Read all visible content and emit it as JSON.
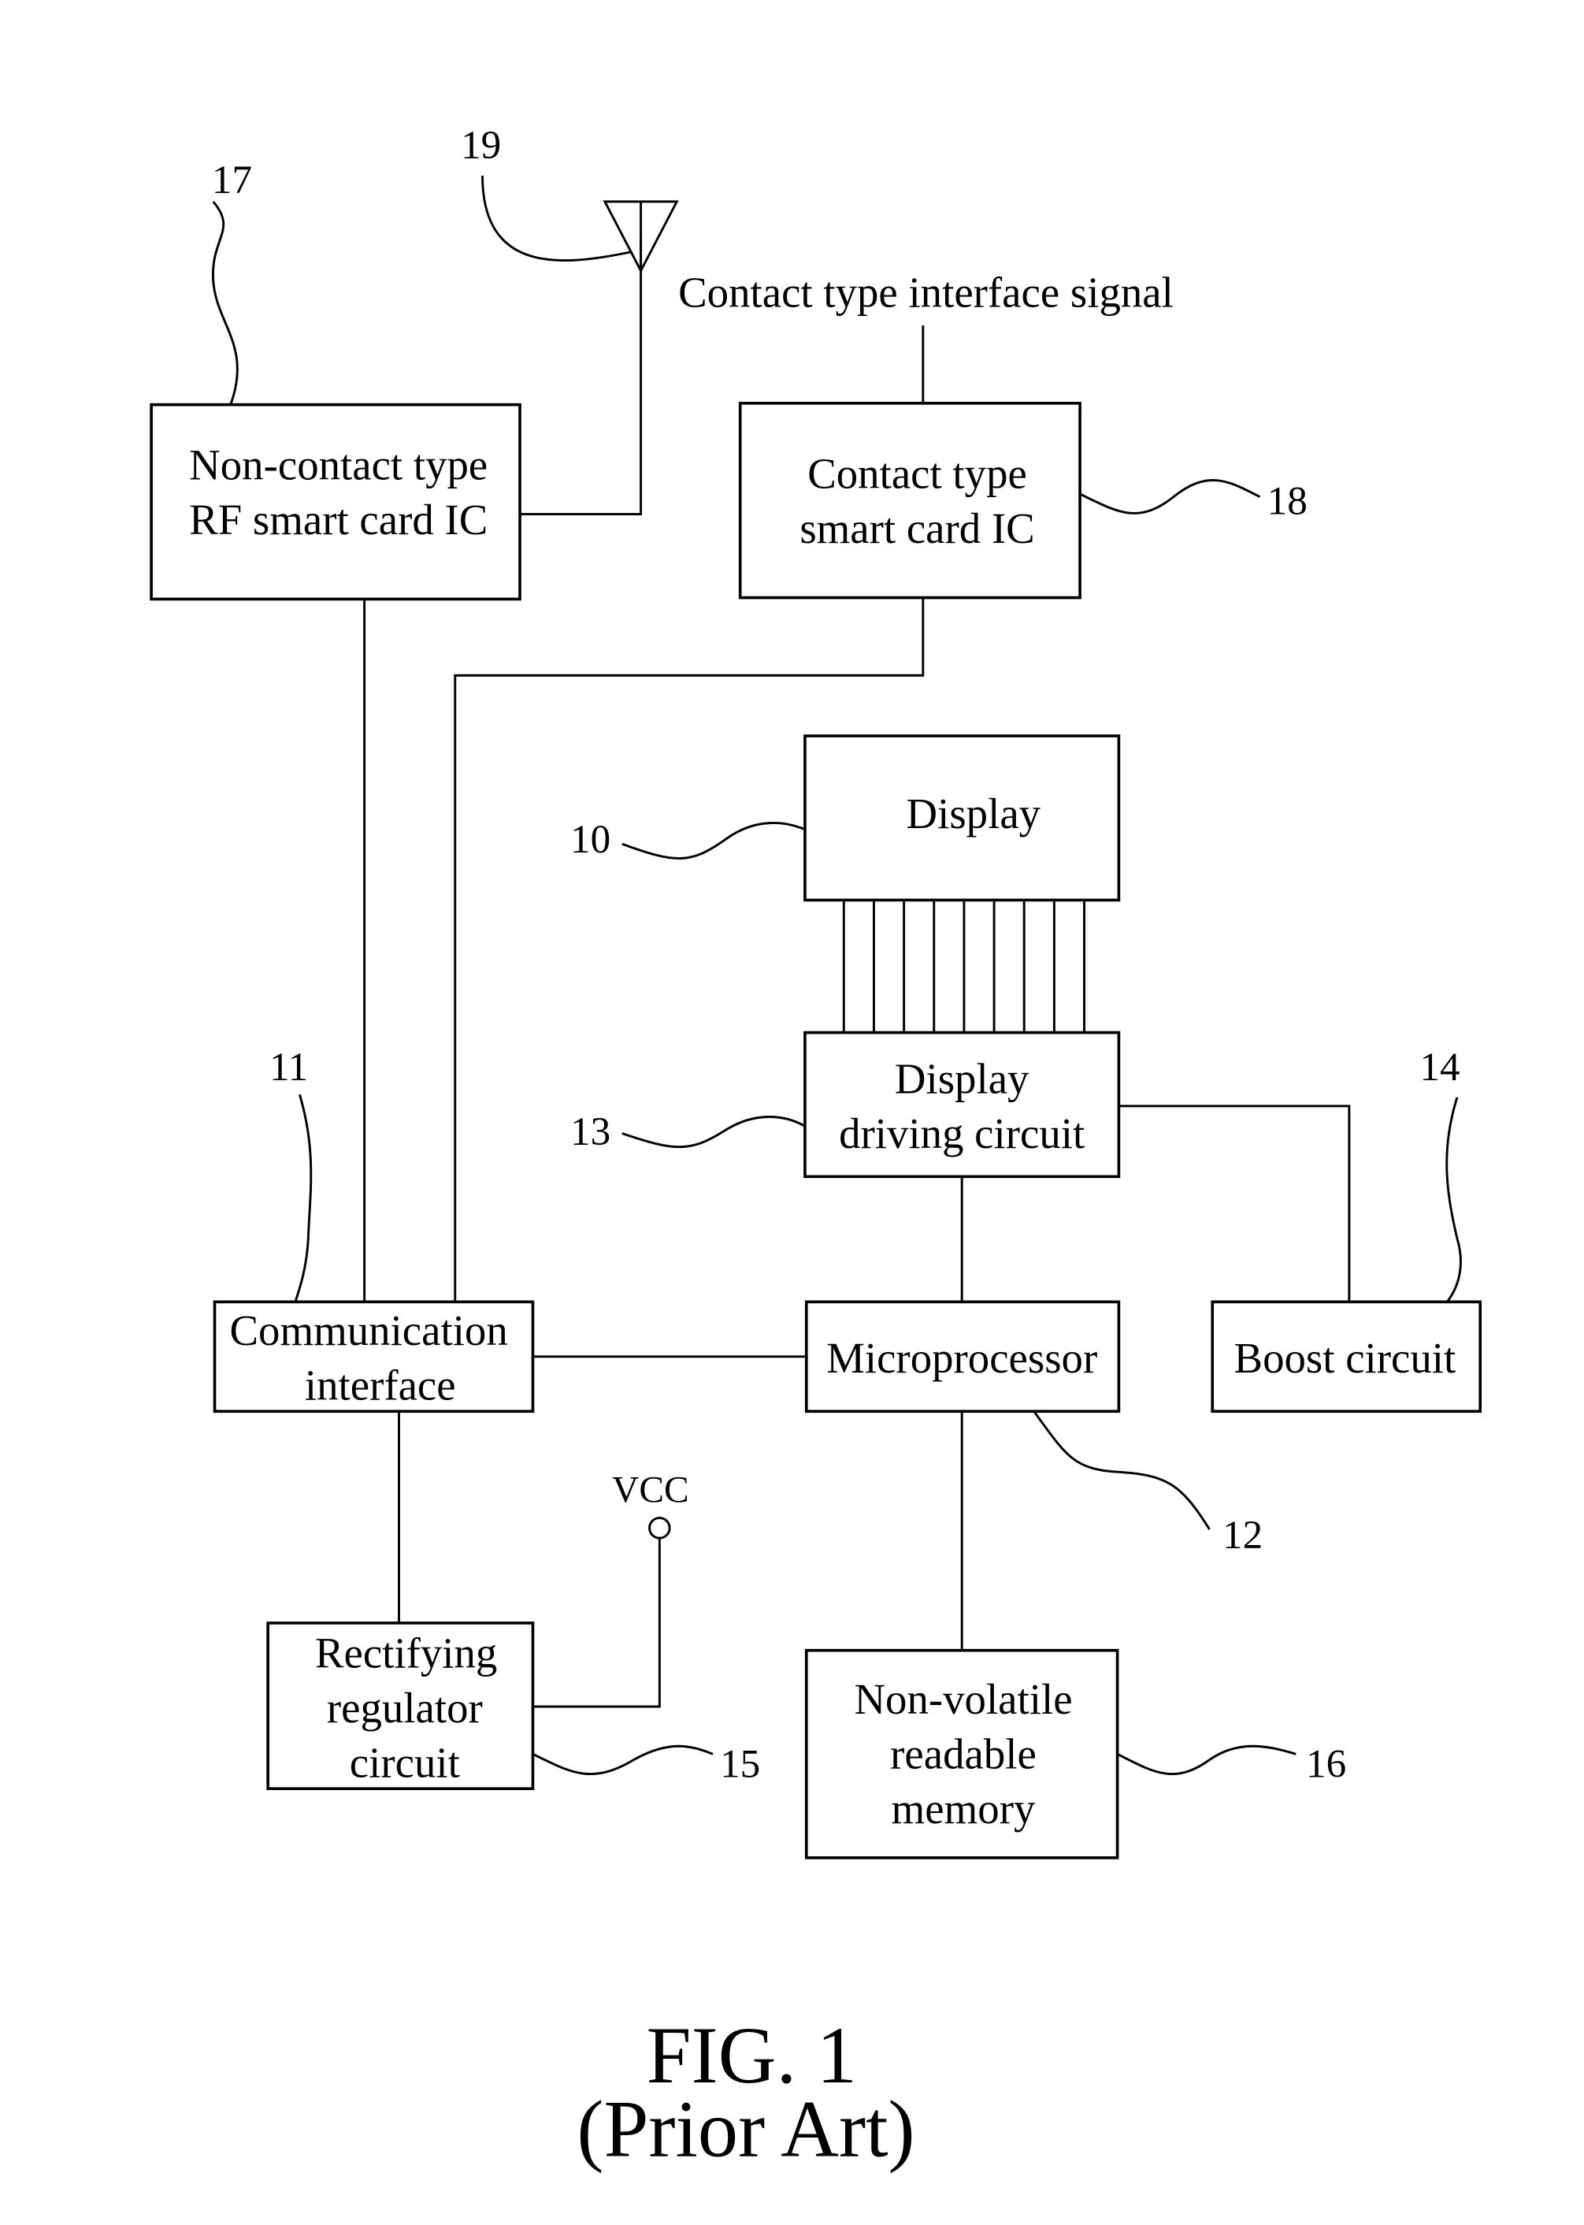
{
  "figure": {
    "caption": "FIG. 1",
    "subcaption": "(Prior Art)"
  },
  "blocks": {
    "rf_ic": {
      "ref": "17",
      "lines": [
        "Non-contact type",
        "RF smart card IC"
      ]
    },
    "contact_ic": {
      "ref": "18",
      "lines": [
        "Contact type",
        "smart card IC"
      ]
    },
    "display": {
      "ref": "10",
      "lines": [
        "Display"
      ]
    },
    "driver": {
      "ref": "13",
      "lines": [
        "Display",
        "driving circuit"
      ]
    },
    "comm": {
      "ref": "11",
      "lines": [
        "Communication",
        "interface"
      ]
    },
    "micro": {
      "ref": "12",
      "lines": [
        "Microprocessor"
      ]
    },
    "boost": {
      "ref": "14",
      "lines": [
        "Boost circuit"
      ]
    },
    "rect": {
      "ref": "15",
      "lines": [
        "Rectifying",
        "regulator",
        "circuit"
      ]
    },
    "nvm": {
      "ref": "16",
      "lines": [
        "Non-volatile",
        "readable",
        "memory"
      ]
    }
  },
  "antenna": {
    "ref": "19"
  },
  "signals": {
    "contact_signal": "Contact type interface signal",
    "vcc": "VCC"
  },
  "bus_line_count": 9
}
